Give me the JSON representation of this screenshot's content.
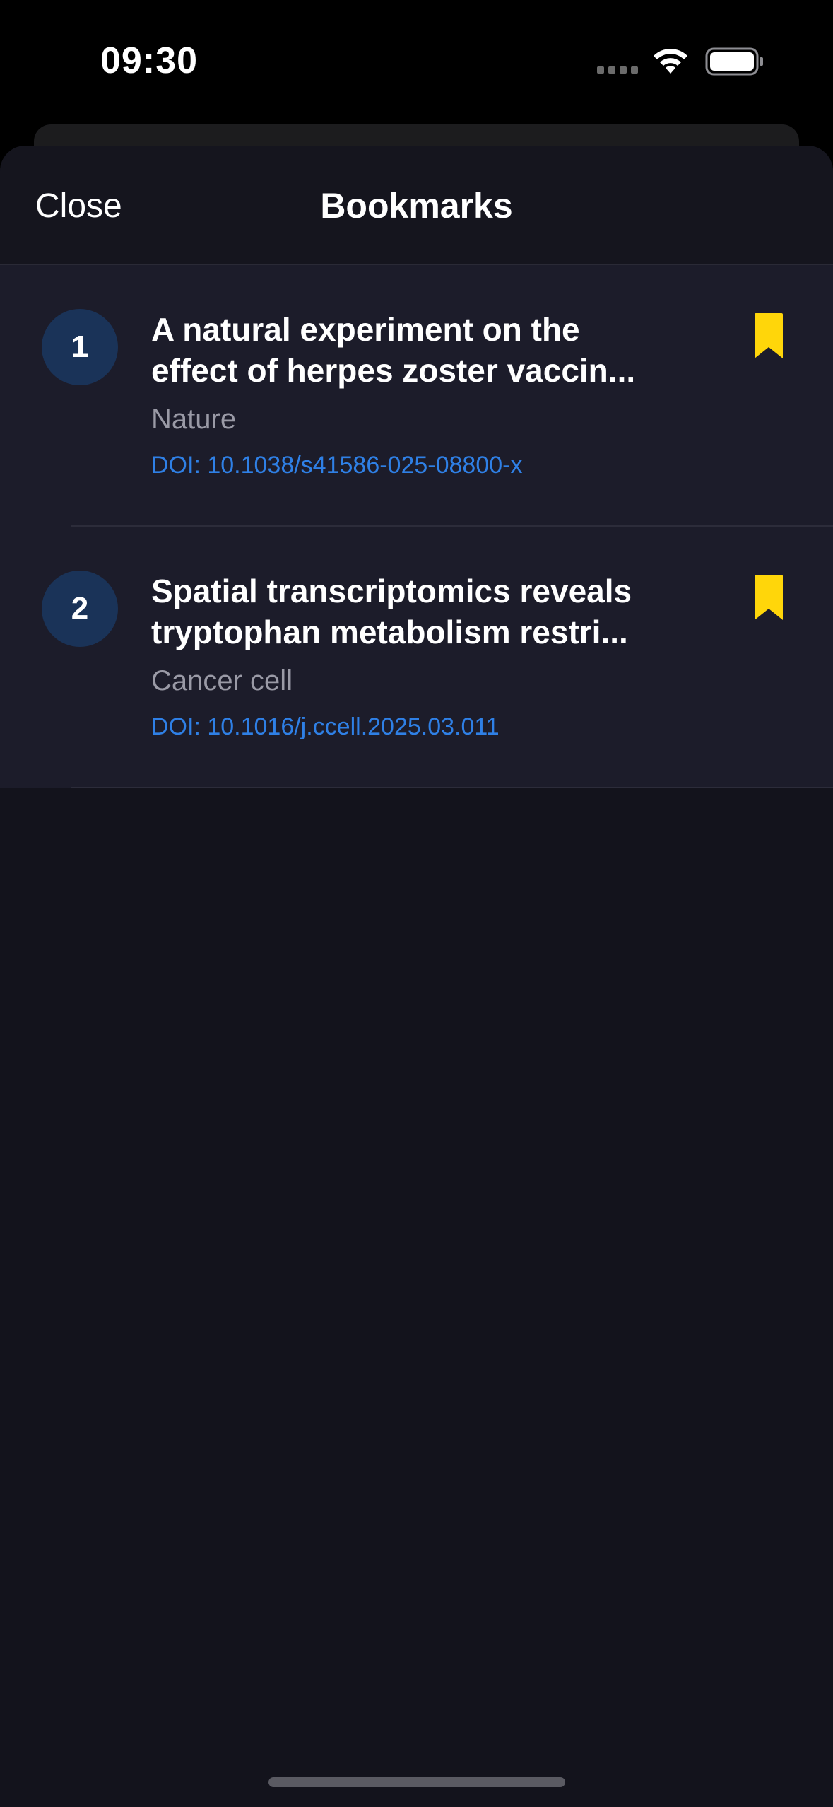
{
  "status_bar": {
    "time": "09:30"
  },
  "nav": {
    "close_label": "Close",
    "title": "Bookmarks"
  },
  "bookmarks": [
    {
      "number": "1",
      "title_line1": "A natural experiment on the",
      "title_line2": "effect of herpes zoster vaccin...",
      "journal": "Nature",
      "doi": "DOI: 10.1038/s41586-025-08800-x"
    },
    {
      "number": "2",
      "title_line1": "Spatial transcriptomics reveals",
      "title_line2": "tryptophan metabolism restri...",
      "journal": "Cancer cell",
      "doi": "DOI: 10.1016/j.ccell.2025.03.011"
    }
  ],
  "colors": {
    "accent_blue": "#2f80e6",
    "bookmark_yellow": "#ffd60a",
    "badge_bg": "#1a3358",
    "sheet_bg": "#13131c",
    "row_bg": "#1c1c2a"
  },
  "icons": {
    "bookmark": "bookmark-filled-icon",
    "wifi": "wifi-icon",
    "battery": "battery-icon"
  }
}
